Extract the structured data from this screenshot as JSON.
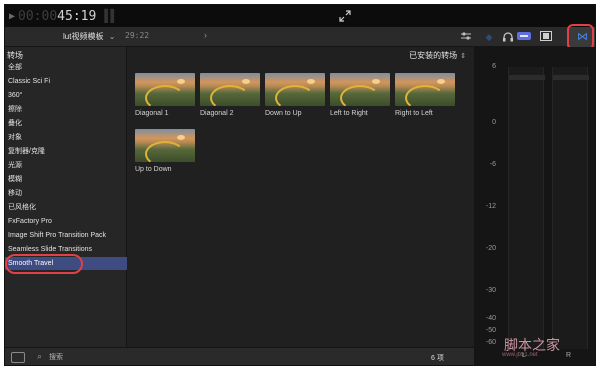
{
  "viewer": {
    "timecode_dim": "00:00",
    "timecode_bright": "45:19"
  },
  "toolbar": {
    "project_name": "lut视频模板",
    "project_chevron": "⌄",
    "duration": "29:22",
    "icons": [
      "fullscreen-icon",
      "sliders-icon",
      "headphones-icon",
      "snap-toggle-icon",
      "filmstrip-icon",
      "inspector-icon",
      "transitions-browser-icon"
    ],
    "accent_color": "#3d8cf0",
    "highlight_color": "#e04048"
  },
  "sidebar": {
    "title": "转场",
    "items": [
      {
        "label": "全部"
      },
      {
        "label": "Classic Sci Fi"
      },
      {
        "label": "360°"
      },
      {
        "label": "擦除"
      },
      {
        "label": "叠化"
      },
      {
        "label": "对象"
      },
      {
        "label": "复制器/克隆"
      },
      {
        "label": "光源"
      },
      {
        "label": "模糊"
      },
      {
        "label": "移动"
      },
      {
        "label": "已风格化"
      },
      {
        "label": "FxFactory Pro"
      },
      {
        "label": "Image Shift Pro Transition Pack"
      },
      {
        "label": "Seamless Slide Transitions"
      },
      {
        "label": "Smooth Travel"
      }
    ],
    "selected_index": 14,
    "selected_color": "#3e4c82"
  },
  "browser": {
    "filter": "已安装的转场",
    "tiles": [
      {
        "label": "Diagonal 1"
      },
      {
        "label": "Diagonal 2"
      },
      {
        "label": "Down to Up"
      },
      {
        "label": "Left to Right"
      },
      {
        "label": "Right to Left"
      },
      {
        "label": "Up to Down"
      }
    ]
  },
  "meters": {
    "ticks": [
      "6",
      "0",
      "-6",
      "-12",
      "-20",
      "-30",
      "-40",
      "-50",
      "-60"
    ],
    "left_channel": "L",
    "right_channel": "R",
    "watermark": "脚本之家",
    "watermark_sub": "www.jb51.net"
  },
  "footer": {
    "search_placeholder": "搜索",
    "count": "6 项"
  }
}
